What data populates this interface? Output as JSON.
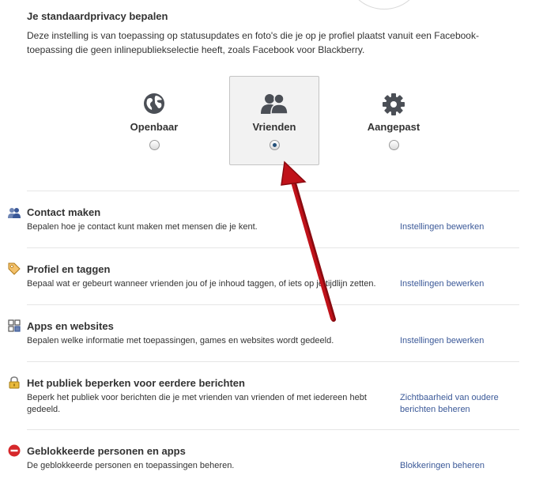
{
  "default_privacy": {
    "heading": "Je standaardprivacy bepalen",
    "description": "Deze instelling is van toepassing op statusupdates en foto's die je op je profiel plaatst vanuit een Facebook-toepassing die geen inlinepubliekselectie heeft, zoals Facebook voor Blackberry.",
    "options": [
      {
        "label": "Openbaar",
        "icon": "globe-icon",
        "selected": false
      },
      {
        "label": "Vrienden",
        "icon": "friends-icon",
        "selected": true
      },
      {
        "label": "Aangepast",
        "icon": "gear-icon",
        "selected": false
      }
    ]
  },
  "sections": [
    {
      "icon": "contact-people-icon",
      "title": "Contact maken",
      "description": "Bepalen hoe je contact kunt maken met mensen die je kent.",
      "link": "Instellingen bewerken"
    },
    {
      "icon": "tag-icon",
      "title": "Profiel en taggen",
      "description": "Bepaal wat er gebeurt wanneer vrienden jou of je inhoud taggen, of iets op je tijdlijn zetten.",
      "link": "Instellingen bewerken"
    },
    {
      "icon": "apps-icon",
      "title": "Apps en websites",
      "description": "Bepalen welke informatie met toepassingen, games en websites wordt gedeeld.",
      "link": "Instellingen bewerken"
    },
    {
      "icon": "lock-icon",
      "title": "Het publiek beperken voor eerdere berichten",
      "description": "Beperk het publiek voor berichten die je met vrienden van vrienden of met iedereen hebt gedeeld.",
      "link": "Zichtbaarheid van oudere berichten beheren"
    },
    {
      "icon": "blocked-icon",
      "title": "Geblokkeerde personen en apps",
      "description": "De geblokkeerde personen en toepassingen beheren.",
      "link": "Blokkeringen beheren"
    }
  ],
  "colors": {
    "link": "#3b5998",
    "arrow": "#b30d14",
    "selected_radio": "#24507a"
  }
}
